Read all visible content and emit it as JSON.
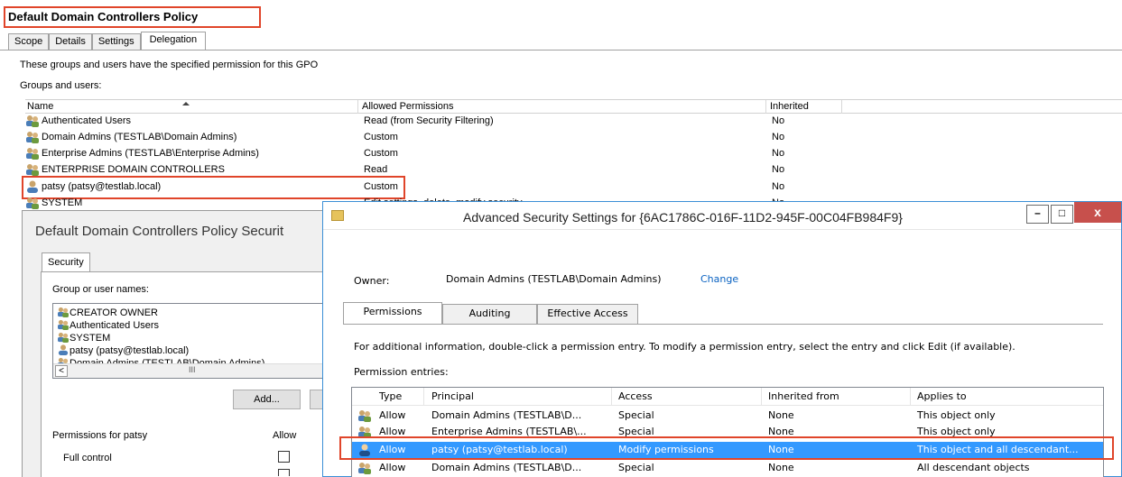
{
  "gpmc": {
    "title": "Default Domain Controllers Policy",
    "tabs": [
      "Scope",
      "Details",
      "Settings",
      "Delegation"
    ],
    "active_tab": "Delegation",
    "description": "These groups and users have the specified permission for this GPO",
    "groups_label": "Groups and users:",
    "columns": [
      "Name",
      "Allowed Permissions",
      "Inherited"
    ],
    "rows": [
      {
        "name": "Authenticated Users",
        "perm": "Read (from Security Filtering)",
        "inherited": "No",
        "icon": "group-icon"
      },
      {
        "name": "Domain Admins (TESTLAB\\Domain Admins)",
        "perm": "Custom",
        "inherited": "No",
        "icon": "group-icon"
      },
      {
        "name": "Enterprise Admins (TESTLAB\\Enterprise Admins)",
        "perm": "Custom",
        "inherited": "No",
        "icon": "group-icon"
      },
      {
        "name": "ENTERPRISE DOMAIN CONTROLLERS",
        "perm": "Read",
        "inherited": "No",
        "icon": "group-icon"
      },
      {
        "name": "patsy (patsy@testlab.local)",
        "perm": "Custom",
        "inherited": "No",
        "icon": "user-icon"
      },
      {
        "name": "SYSTEM",
        "perm": "Edit settings, delete, modify security",
        "inherited": "No",
        "icon": "group-icon"
      }
    ]
  },
  "props_dialog": {
    "title": "Default Domain Controllers Policy Securit",
    "tab": "Security",
    "group_label": "Group or user names:",
    "users": [
      {
        "name": "CREATOR OWNER",
        "icon": "group-icon"
      },
      {
        "name": "Authenticated Users",
        "icon": "group-icon"
      },
      {
        "name": "SYSTEM",
        "icon": "group-icon"
      },
      {
        "name": "patsy (patsy@testlab.local)",
        "icon": "user-icon"
      },
      {
        "name": "Domain Admins (TESTLAB\\Domain Admins)",
        "icon": "group-icon"
      }
    ],
    "scroll_left": "<",
    "scroll_thumb": "III",
    "add_button": "Add...",
    "perms_label": "Permissions for patsy",
    "allow_label": "Allow",
    "perm_rows": [
      "Full control"
    ]
  },
  "adv_dialog": {
    "title": "Advanced Security Settings for {6AC1786C-016F-11D2-945F-00C04FB984F9}",
    "minimize": "–",
    "maximize": "□",
    "close": "x",
    "owner_label": "Owner:",
    "owner_value": "Domain Admins (TESTLAB\\Domain Admins)",
    "change_link": "Change",
    "tabs": [
      "Permissions",
      "Auditing",
      "Effective Access"
    ],
    "info": "For additional information, double-click a permission entry. To modify a permission entry, select the entry and click Edit (if available).",
    "entries_label": "Permission entries:",
    "columns": [
      "Type",
      "Principal",
      "Access",
      "Inherited from",
      "Applies to"
    ],
    "entries": [
      {
        "type": "Allow",
        "principal": "Domain Admins (TESTLAB\\D...",
        "access": "Special",
        "inherited": "None",
        "applies": "This object only",
        "icon": "group-icon"
      },
      {
        "type": "Allow",
        "principal": "Enterprise Admins (TESTLAB\\...",
        "access": "Special",
        "inherited": "None",
        "applies": "This object only",
        "icon": "group-icon"
      },
      {
        "type": "Allow",
        "principal": "patsy (patsy@testlab.local)",
        "access": "Modify permissions",
        "inherited": "None",
        "applies": "This object and all descendant...",
        "icon": "user-icon",
        "selected": true
      },
      {
        "type": "Allow",
        "principal": "Domain Admins (TESTLAB\\D...",
        "access": "Special",
        "inherited": "None",
        "applies": "All descendant objects",
        "icon": "group-icon"
      }
    ]
  },
  "colors": {
    "highlight": "#e0452a",
    "selection": "#3399ff",
    "link": "#0b63c2"
  }
}
